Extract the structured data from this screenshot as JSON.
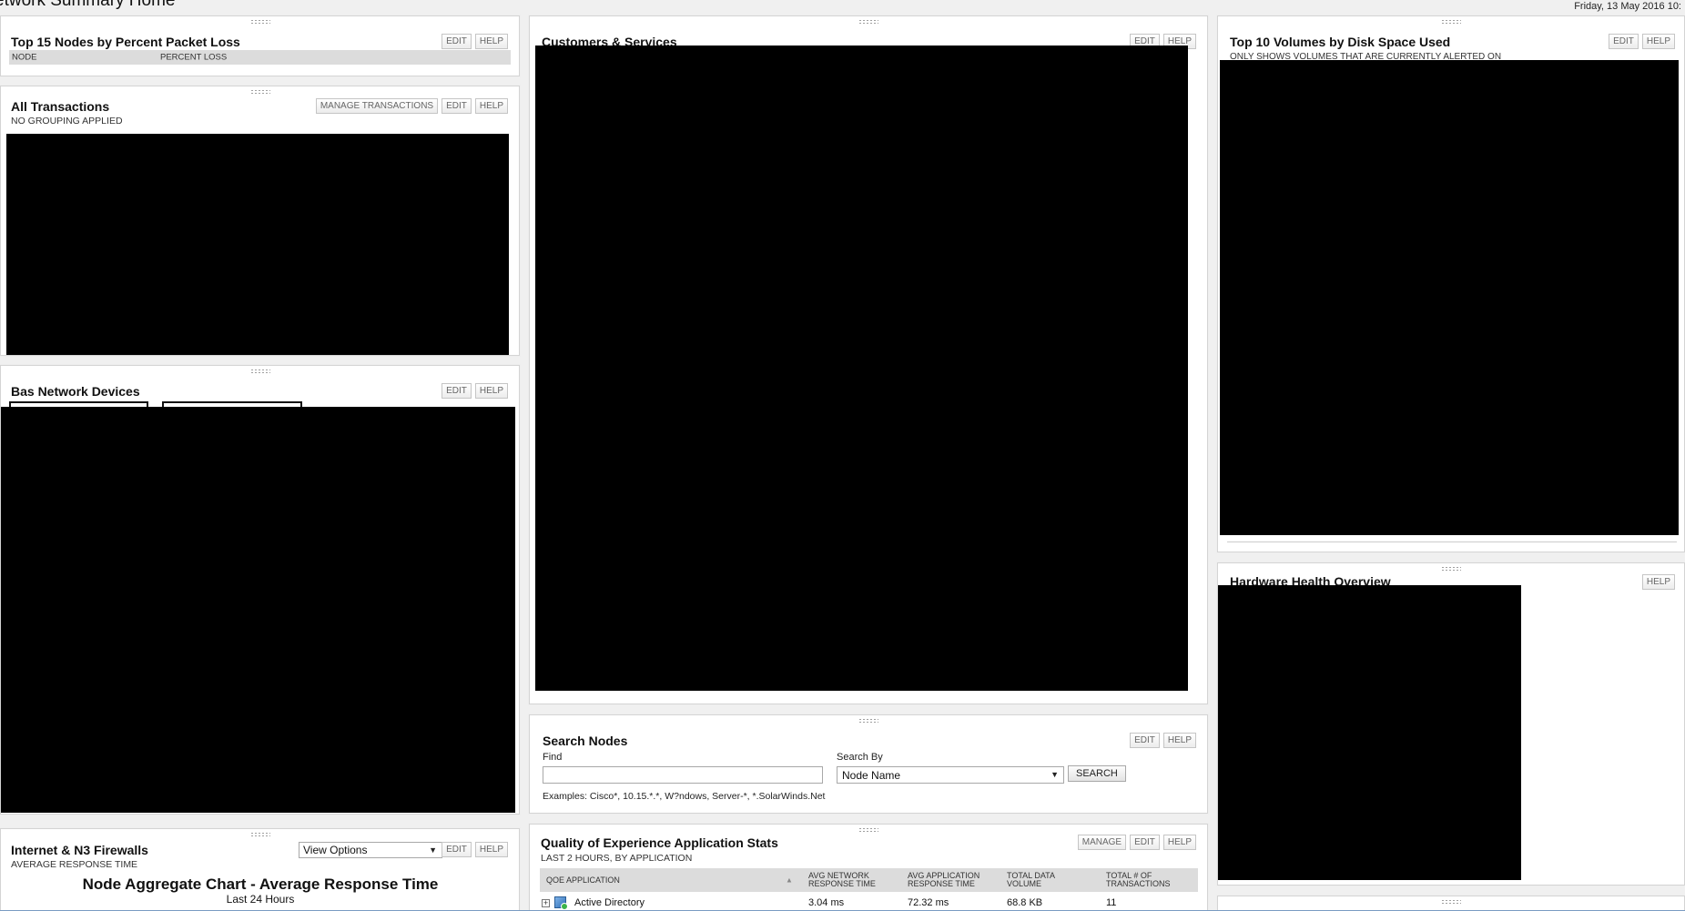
{
  "page": {
    "title": "etwork Summary Home",
    "date": "Friday, 13 May 2016 10:"
  },
  "buttons": {
    "edit": "EDIT",
    "help": "HELP",
    "manage_transactions": "MANAGE TRANSACTIONS",
    "manage": "MANAGE",
    "search": "SEARCH"
  },
  "packet_loss": {
    "title": "Top 15 Nodes by Percent Packet Loss",
    "columns": [
      "NODE",
      "PERCENT LOSS"
    ]
  },
  "transactions": {
    "title": "All Transactions",
    "subtitle": "NO GROUPING APPLIED"
  },
  "bas_devices": {
    "title": "Bas Network Devices"
  },
  "firewalls": {
    "title": "Internet & N3 Firewalls",
    "subtitle": "AVERAGE RESPONSE TIME",
    "view_options": "View Options",
    "chart_title": "Node Aggregate Chart - Average Response Time",
    "chart_subtitle": "Last 24 Hours"
  },
  "customers": {
    "title": "Customers & Services"
  },
  "search_nodes": {
    "title": "Search Nodes",
    "find_label": "Find",
    "find_value": "",
    "search_by_label": "Search By",
    "search_by_value": "Node Name",
    "examples": "Examples: Cisco*, 10.15.*.*, W?ndows, Server-*, *.SolarWinds.Net"
  },
  "qoe": {
    "title": "Quality of Experience Application Stats",
    "subtitle": "LAST 2 HOURS, BY APPLICATION",
    "columns": {
      "app": "QOE APPLICATION",
      "net_1": "AVG NETWORK",
      "net_2": "RESPONSE TIME",
      "appt_1": "AVG APPLICATION",
      "appt_2": "RESPONSE TIME",
      "vol_1": "TOTAL DATA",
      "vol_2": "VOLUME",
      "tx_1": "TOTAL # OF",
      "tx_2": "TRANSACTIONS"
    },
    "rows": [
      {
        "app": "Active Directory",
        "net": "3.04 ms",
        "appt": "72.32 ms",
        "vol": "68.8 KB",
        "tx": "11"
      }
    ]
  },
  "volumes": {
    "title": "Top 10 Volumes by Disk Space Used",
    "subtitle": "ONLY SHOWS VOLUMES THAT ARE CURRENTLY ALERTED ON"
  },
  "hardware": {
    "title": "Hardware Health Overview"
  },
  "colors": {
    "page_bg": "#f0f0f0",
    "panel_border": "#d4d4d4",
    "header_bg": "#dcdcdc",
    "redaction": "#000000"
  }
}
